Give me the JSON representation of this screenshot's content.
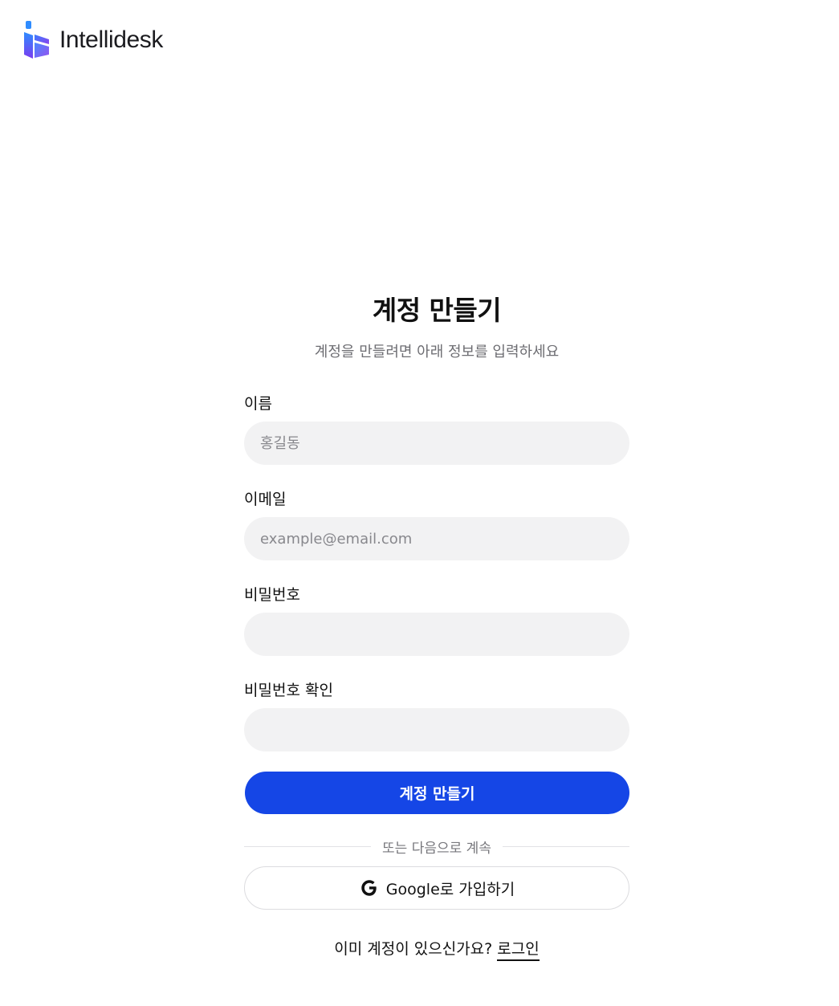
{
  "brand": {
    "name": "Intellidesk"
  },
  "form": {
    "title": "계정 만들기",
    "subtitle": "계정을 만들려면 아래 정보를 입력하세요",
    "fields": {
      "name": {
        "label": "이름",
        "placeholder": "홍길동",
        "value": ""
      },
      "email": {
        "label": "이메일",
        "placeholder": "example@email.com",
        "value": ""
      },
      "password": {
        "label": "비밀번호",
        "placeholder": "",
        "value": ""
      },
      "password_confirm": {
        "label": "비밀번호 확인",
        "placeholder": "",
        "value": ""
      }
    },
    "submit_label": "계정 만들기",
    "divider_text": "또는 다음으로 계속",
    "google_label": "Google로 가입하기",
    "signin_prompt": "이미 계정이 있으신가요?",
    "signin_link": "로그인"
  },
  "colors": {
    "accent": "#1546e6",
    "input_bg": "#f2f2f3",
    "logo_gradient_top": "#2f8cff",
    "logo_gradient_bottom": "#7a3cf0"
  },
  "icons": {
    "logo": "intellidesk-logo-icon",
    "google": "google-icon"
  }
}
